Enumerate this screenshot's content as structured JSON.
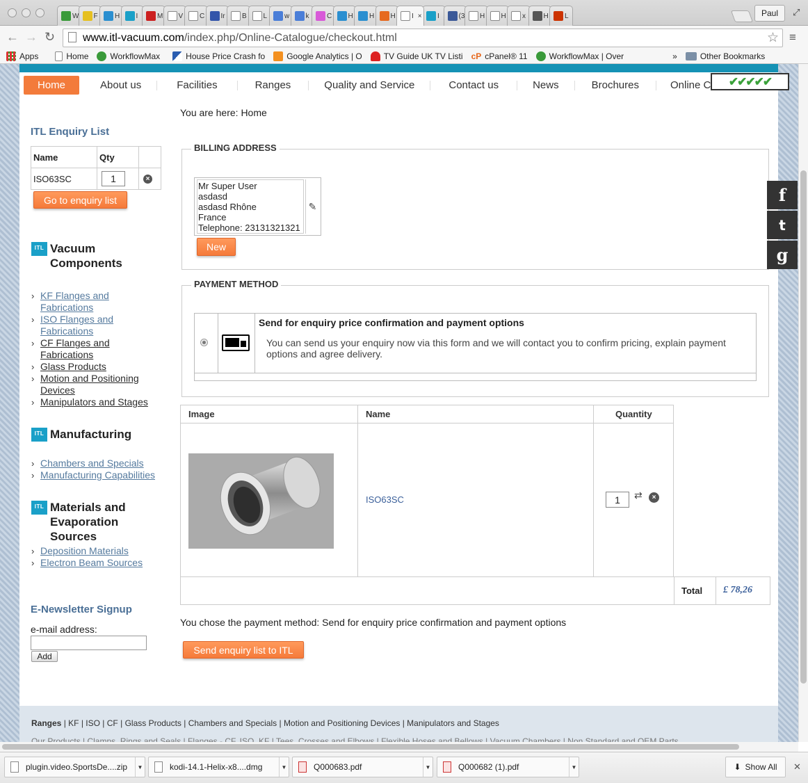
{
  "browser": {
    "tabs": [
      {
        "label": "W",
        "fav": "workflowmax-icon",
        "color": "#3a9a3a"
      },
      {
        "label": "F",
        "fav": "emoji-icon",
        "color": "#e6c020"
      },
      {
        "label": "H",
        "fav": "snowflake-icon",
        "color": "#2b8fd0"
      },
      {
        "label": "I",
        "fav": "itl-icon",
        "color": "#1aa0c8"
      },
      {
        "label": "M",
        "fav": "question-icon",
        "color": "#cc2020"
      },
      {
        "label": "V",
        "fav": "page-icon",
        "color": "#ffffff"
      },
      {
        "label": "C",
        "fav": "circle-icon",
        "color": "#ffffff"
      },
      {
        "label": "Ir",
        "fav": "calendar-icon",
        "color": "#3355aa"
      },
      {
        "label": "B",
        "fav": "page-icon",
        "color": "#ffffff"
      },
      {
        "label": "L",
        "fav": "page-icon",
        "color": "#ffffff"
      },
      {
        "label": "w",
        "fav": "google-icon",
        "color": "#4a7ed8"
      },
      {
        "label": "k",
        "fav": "google-icon",
        "color": "#4a7ed8"
      },
      {
        "label": "C",
        "fav": "colorful-icon",
        "color": "#d85ad8"
      },
      {
        "label": "H",
        "fav": "snowflake-icon",
        "color": "#2b8fd0"
      },
      {
        "label": "H",
        "fav": "snowflake-icon",
        "color": "#2b8fd0"
      },
      {
        "label": "H",
        "fav": "joomla-icon",
        "color": "#e66a20"
      },
      {
        "label": "I",
        "fav": "page-icon",
        "color": "#ffffff",
        "active": true
      },
      {
        "label": "I",
        "fav": "itl-icon",
        "color": "#1aa0c8"
      },
      {
        "label": "(3",
        "fav": "facebook-icon",
        "color": "#3b5998"
      },
      {
        "label": "H",
        "fav": "page-icon",
        "color": "#ffffff"
      },
      {
        "label": "H",
        "fav": "page-icon",
        "color": "#ffffff"
      },
      {
        "label": "x",
        "fav": "page-icon",
        "color": "#ffffff"
      },
      {
        "label": "H",
        "fav": "apple-icon",
        "color": "#555555"
      },
      {
        "label": "L",
        "fav": "xampp-icon",
        "color": "#cc3300"
      }
    ],
    "profile": "Paul",
    "url_host": "www.itl-vacuum.com",
    "url_path": "/index.php/Online-Catalogue/checkout.html",
    "bookmarks": [
      "Apps",
      "Home",
      "WorkflowMax",
      "House Price Crash fo",
      "Google Analytics | O",
      "TV Guide UK TV Listi",
      "cPanel® 11",
      "WorkflowMax | Over"
    ],
    "bookmark_overflow": "»",
    "other_bookmarks": "Other Bookmarks"
  },
  "nav": {
    "items": [
      "Home",
      "About us",
      "Facilities",
      "Ranges",
      "Quality and Service",
      "Contact us",
      "News",
      "Brochures",
      "Online Catal"
    ],
    "checkmarks": "✔✔✔✔✔"
  },
  "breadcrumb": "You are here: Home",
  "sidebar": {
    "enquiry_title": "ITL Enquiry List",
    "col_name": "Name",
    "col_qty": "Qty",
    "item_name": "ISO63SC",
    "item_qty": "1",
    "go_button": "Go to enquiry list",
    "logo_text": "ITL",
    "vacuum_title": "Vacuum Components",
    "vacuum_links": [
      {
        "text": "KF Flanges and Fabrications",
        "muted": true
      },
      {
        "text": "ISO Flanges and Fabrications",
        "muted": true
      },
      {
        "text": "CF Flanges and Fabrications",
        "muted": false
      },
      {
        "text": "Glass Products",
        "muted": false
      },
      {
        "text": "Motion and Positioning Devices",
        "muted": false
      },
      {
        "text": "Manipulators and Stages",
        "muted": false
      }
    ],
    "manufacturing_title": "Manufacturing",
    "manufacturing_links": [
      "Chambers and Specials",
      "Manufacturing Capabilities"
    ],
    "materials_title": "Materials and Evaporation Sources",
    "materials_links": [
      "Deposition Materials",
      "Electron Beam Sources"
    ],
    "newsletter_title": "E-Newsletter Signup",
    "email_label": "e-mail address:",
    "email_value": "",
    "add_button": "Add"
  },
  "billing": {
    "legend": "BILLING ADDRESS",
    "lines": [
      "Mr Super User",
      "asdasd",
      "asdasd Rhône",
      "France",
      "Telephone: 23131321321"
    ],
    "new_button": "New"
  },
  "payment": {
    "legend": "PAYMENT METHOD",
    "title": "Send for enquiry price confirmation and payment options",
    "desc": "You can send us your enquiry now via this form and we will contact you to confirm pricing, explain payment options and agree delivery."
  },
  "products": {
    "col_image": "Image",
    "col_name": "Name",
    "col_qty": "Quantity",
    "name": "ISO63SC",
    "qty": "1",
    "total_label": "Total",
    "total_value": "£ 78,26"
  },
  "chosen_text": "You chose the payment method: Send for enquiry price confirmation and payment options",
  "send_button": "Send enquiry list to ITL",
  "footer": {
    "ranges_label": "Ranges",
    "ranges_links": [
      "KF",
      "ISO",
      "CF",
      "Glass Products",
      "Chambers and Specials",
      "Motion and Positioning Devices",
      "Manipulators and Stages"
    ],
    "second_line": "Our Products | Clamps, Rings and Seals | Flanges - CF, ISO, KF | Tees, Crosses and Elbows | Flexible Hoses and Bellows | Vacuum Chambers | Non Standard and OEM Parts"
  },
  "social": {
    "facebook": "f",
    "twitter": "t",
    "google": "g"
  },
  "downloads": [
    {
      "name": "plugin.video.SportsDe....zip",
      "type": "zip"
    },
    {
      "name": "kodi-14.1-Helix-x8....dmg",
      "type": "dmg"
    },
    {
      "name": "Q000683.pdf",
      "type": "pdf"
    },
    {
      "name": "Q000682 (1).pdf",
      "type": "pdf"
    }
  ],
  "show_all": "Show All",
  "colors": {
    "accent": "#f37b3b",
    "heading": "#4a6f96",
    "brand": "#1aa0c8",
    "total": "#3a5f9a"
  }
}
